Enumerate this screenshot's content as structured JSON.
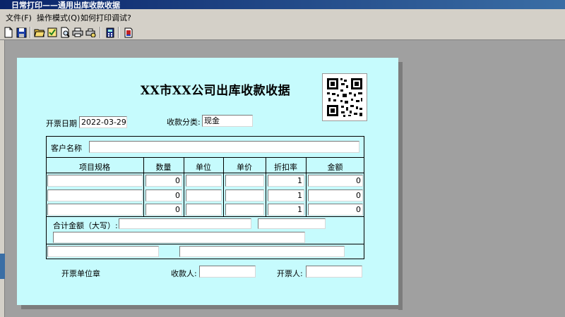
{
  "window": {
    "title": "日常打印——通用出库收款收据"
  },
  "menu": [
    {
      "label": "文件(F)"
    },
    {
      "label": "操作模式(Q)"
    },
    {
      "label": "如何打印调试?"
    }
  ],
  "toolbar": {
    "buttons": [
      {
        "icon": "new-file-icon"
      },
      {
        "icon": "save-icon"
      },
      {
        "icon": "open-folder-icon"
      },
      {
        "icon": "checkbox-icon"
      },
      {
        "icon": "print-preview-icon"
      },
      {
        "icon": "printer-icon"
      },
      {
        "icon": "print-setup-icon"
      },
      {
        "icon": "calculator-icon"
      },
      {
        "icon": "help-icon"
      }
    ]
  },
  "receipt": {
    "title": "XX市XX公司出库收款收据",
    "date_label": "开票日期",
    "date_value": "2022-03-29",
    "category_label": "收款分类:",
    "category_value": "现金",
    "customer_label": "客户名称",
    "customer_value": "",
    "columns": [
      "项目规格",
      "数量",
      "单位",
      "单价",
      "折扣率",
      "金额"
    ],
    "rows": [
      {
        "spec": "",
        "qty": "0",
        "unit": "",
        "price": "",
        "discount": "1",
        "amount": "0"
      },
      {
        "spec": "",
        "qty": "0",
        "unit": "",
        "price": "",
        "discount": "1",
        "amount": "0"
      },
      {
        "spec": "",
        "qty": "0",
        "unit": "",
        "price": "",
        "discount": "1",
        "amount": "0"
      }
    ],
    "total_label": "合计金额（大写）:",
    "stamp_label": "开票单位章",
    "payee_label": "收款人:",
    "issuer_label": "开票人:"
  }
}
